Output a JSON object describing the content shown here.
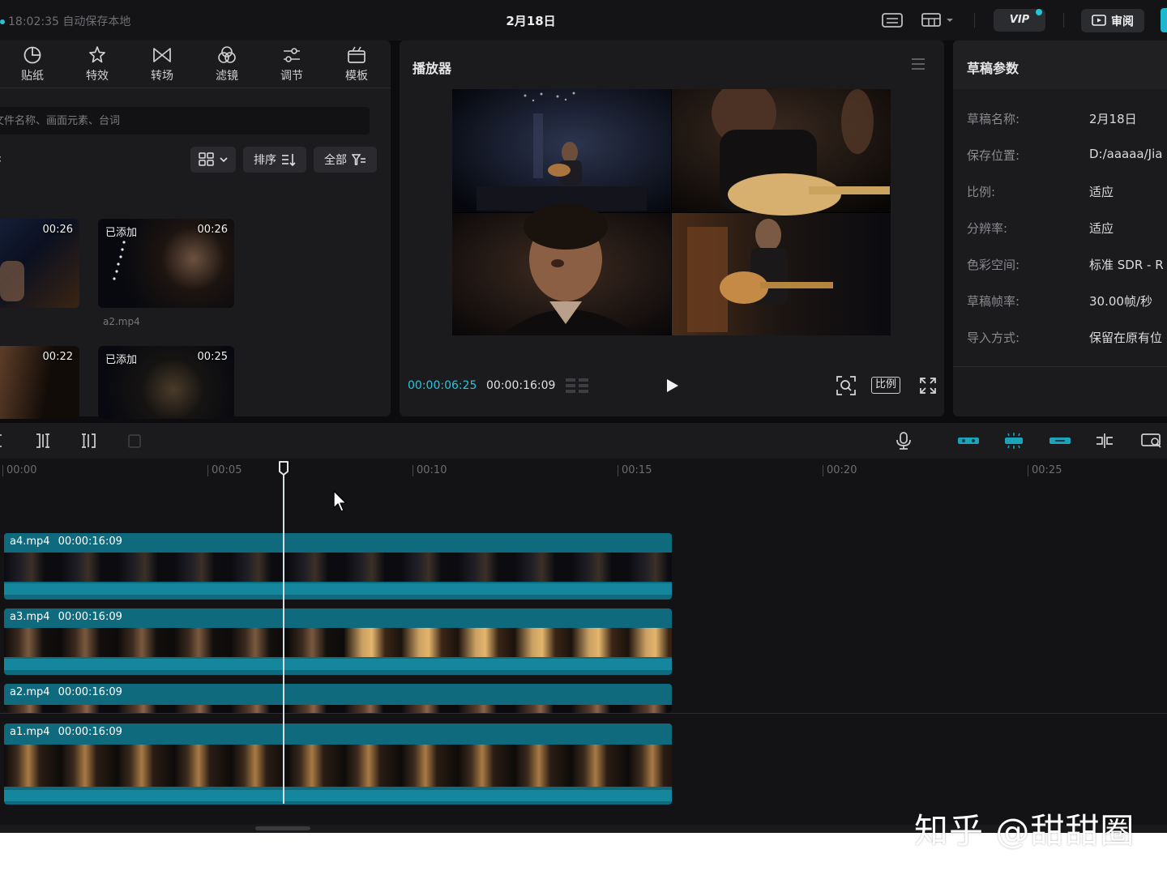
{
  "topbar": {
    "autosave_text": "18:02:35 自动保存本地",
    "project_title": "2月18日",
    "vip_label": "VIP",
    "review_label": "审阅"
  },
  "media_panel": {
    "tabs": [
      {
        "label": "贴纸",
        "icon": "sticker-icon"
      },
      {
        "label": "特效",
        "icon": "effects-star-icon"
      },
      {
        "label": "转场",
        "icon": "transition-bowtie-icon"
      },
      {
        "label": "滤镜",
        "icon": "filter-circles-icon"
      },
      {
        "label": "调节",
        "icon": "adjust-sliders-icon"
      },
      {
        "label": "模板",
        "icon": "template-icon"
      }
    ],
    "search_placeholder": "文件名称、画面元素、台词",
    "sort_label": "排序",
    "filter_label": "全部",
    "clips": [
      {
        "badge": "",
        "duration": "00:26",
        "name": ""
      },
      {
        "badge": "已添加",
        "duration": "00:26",
        "name": "a2.mp4"
      },
      {
        "badge": "",
        "duration": "00:22",
        "name": ""
      },
      {
        "badge": "已添加",
        "duration": "00:25",
        "name": ""
      }
    ]
  },
  "player": {
    "title": "播放器",
    "current_time": "00:00:06:25",
    "total_time": "00:00:16:09",
    "ratio_label": "比例"
  },
  "properties": {
    "title": "草稿参数",
    "rows": [
      {
        "key": "草稿名称:",
        "value": "2月18日"
      },
      {
        "key": "保存位置:",
        "value": "D:/aaaaa/Jia"
      },
      {
        "key": "比例:",
        "value": "适应"
      },
      {
        "key": "分辨率:",
        "value": "适应"
      },
      {
        "key": "色彩空间:",
        "value": "标准 SDR - R"
      },
      {
        "key": "草稿帧率:",
        "value": "30.00帧/秒"
      },
      {
        "key": "导入方式:",
        "value": "保留在原有位"
      }
    ]
  },
  "timeline": {
    "ruler_ticks": [
      "00:00",
      "00:05",
      "00:10",
      "00:15",
      "00:20",
      "00:25"
    ],
    "tracks": [
      {
        "name": "a4.mp4",
        "duration": "00:00:16:09"
      },
      {
        "name": "a3.mp4",
        "duration": "00:00:16:09"
      },
      {
        "name": "a2.mp4",
        "duration": "00:00:16:09"
      },
      {
        "name": "a1.mp4",
        "duration": "00:00:16:09"
      }
    ]
  },
  "watermark": "知乎 @甜甜圈",
  "colors": {
    "accent": "#21c5d9",
    "track": "#0f6a7e",
    "panel": "#1b1b1e",
    "background": "#0c0c0e"
  }
}
